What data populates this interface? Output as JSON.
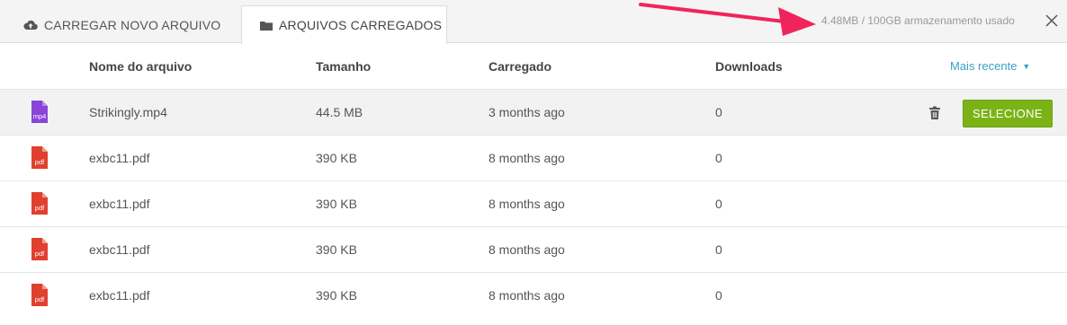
{
  "tabs": {
    "upload_label": "CARREGAR NOVO ARQUIVO",
    "uploaded_label": "ARQUIVOS CARREGADOS"
  },
  "storage_text": "4.48MB / 100GB armazenamento usado",
  "columns": {
    "name": "Nome do arquivo",
    "size": "Tamanho",
    "uploaded": "Carregado",
    "downloads": "Downloads"
  },
  "sort_label": "Mais recente",
  "select_label": "SELECIONE",
  "files": [
    {
      "icon": "mp4-file-icon",
      "icon_label": "mp4",
      "name": "Strikingly.mp4",
      "size": "44.5 MB",
      "uploaded": "3 months ago",
      "downloads": "0"
    },
    {
      "icon": "pdf-file-icon",
      "icon_label": "pdf",
      "name": "exbc11.pdf",
      "size": "390 KB",
      "uploaded": "8 months ago",
      "downloads": "0"
    },
    {
      "icon": "pdf-file-icon",
      "icon_label": "pdf",
      "name": "exbc11.pdf",
      "size": "390 KB",
      "uploaded": "8 months ago",
      "downloads": "0"
    },
    {
      "icon": "pdf-file-icon",
      "icon_label": "pdf",
      "name": "exbc11.pdf",
      "size": "390 KB",
      "uploaded": "8 months ago",
      "downloads": "0"
    },
    {
      "icon": "pdf-file-icon",
      "icon_label": "pdf",
      "name": "exbc11.pdf",
      "size": "390 KB",
      "uploaded": "8 months ago",
      "downloads": "0"
    }
  ],
  "colors": {
    "mp4_icon": "#8a44d8",
    "pdf_icon": "#e0402f",
    "select_button": "#7bb317",
    "sort_link": "#3aa0c8",
    "arrow": "#f0245c"
  }
}
